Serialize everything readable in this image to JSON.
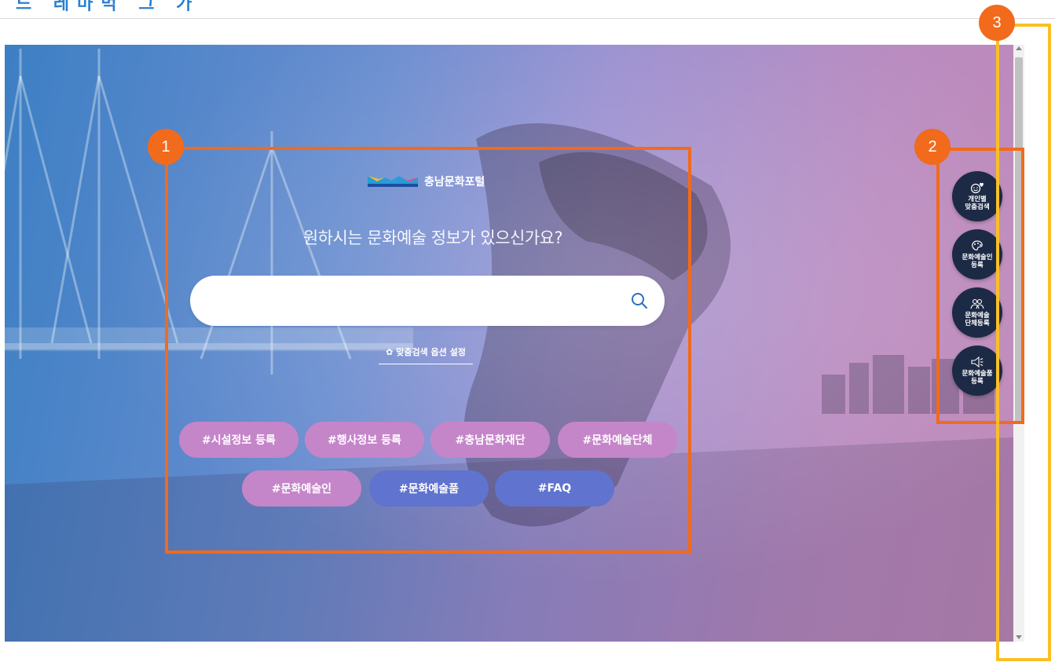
{
  "top_strip": {
    "title": "드 레마먹 그 가"
  },
  "logo": {
    "text": "충남문화포털"
  },
  "headline": "원하시는 문화예술 정보가 있으신가요?",
  "search": {
    "value": "",
    "placeholder": ""
  },
  "option_link": "✿ 맞춤검색 옵션 설정",
  "tags": [
    {
      "label": "#시설정보 등록",
      "color": "pink"
    },
    {
      "label": "#행사정보 등록",
      "color": "pink"
    },
    {
      "label": "#충남문화재단",
      "color": "pink"
    },
    {
      "label": "#문화예술단체",
      "color": "pink"
    },
    {
      "label": "#문화예술인",
      "color": "pink"
    },
    {
      "label": "#문화예술품",
      "color": "blue"
    },
    {
      "label": "#FAQ",
      "color": "blue"
    }
  ],
  "quick_menu": [
    {
      "label": "개인별\n맞춤검색",
      "icon": "smile-heart-icon"
    },
    {
      "label": "문화예술인\n등록",
      "icon": "palette-icon"
    },
    {
      "label": "문화예술\n단체등록",
      "icon": "people-icon"
    },
    {
      "label": "문화예술품\n등록",
      "icon": "megaphone-icon"
    }
  ],
  "annotations": [
    "1",
    "2",
    "3"
  ],
  "colors": {
    "accent": "#f26a1b",
    "highlight": "#fbbf24",
    "quick_bg": "#1d2a45",
    "tag_pink": "#c585c9",
    "tag_blue": "#5f73cf"
  }
}
